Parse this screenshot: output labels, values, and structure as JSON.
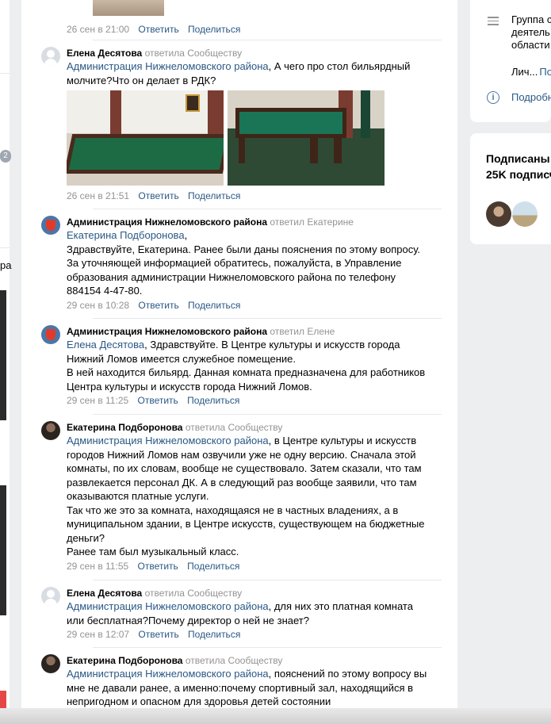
{
  "left_sidebar": {
    "badge": "2",
    "text": "ра"
  },
  "comments": [
    {
      "id": "c0",
      "meta": {
        "time": "26 сен в 21:00",
        "reply": "Ответить",
        "share": "Поделиться"
      }
    },
    {
      "id": "c1",
      "author": "Елена Десятова",
      "replied": "ответила Сообществу",
      "mention": "Администрация Нижнеломовского района",
      "text_after_mention": ", А чего про стол бильярдный молчите?Что он делает в РДК?",
      "meta": {
        "time": "26 сен в 21:51",
        "reply": "Ответить",
        "share": "Поделиться"
      }
    },
    {
      "id": "c2",
      "author": "Администрация Нижнеломовского района",
      "replied": "ответил Екатерине",
      "mention": "Екатерина Подборонова",
      "text_after_mention": ",",
      "paragraphs": [
        "Здравствуйте, Екатерина. Ранее были даны пояснения по этому вопросу. За уточняющей информацией обратитесь, пожалуйста, в Управление образования администрации Нижнеломовского района по телефону 884154 4-47-80."
      ],
      "meta": {
        "time": "29 сен в 10:28",
        "reply": "Ответить",
        "share": "Поделиться"
      }
    },
    {
      "id": "c3",
      "author": "Администрация Нижнеломовского района",
      "replied": "ответил Елене",
      "mention": "Елена Десятова",
      "text_after_mention": ", Здравствуйте. В Центре культуры и искусств города Нижний Ломов имеется служебное помещение.",
      "paragraphs": [
        "В ней находится бильярд. Данная комната предназначена для работников Центра культуры и искусств города Нижний Ломов."
      ],
      "meta": {
        "time": "29 сен в 11:25",
        "reply": "Ответить",
        "share": "Поделиться"
      }
    },
    {
      "id": "c4",
      "author": "Екатерина Подборонова",
      "replied": "ответила Сообществу",
      "mention": "Администрация Нижнеломовского района",
      "text_after_mention": ", в Центре культуры и искусств городов Нижний Ломов нам озвучили уже не одну версию. Сначала этой комнаты, по их словам, вообще не существовало. Затем сказали, что там развлекается персонал ДК. А в следующий раз вообще заявили, что там оказываются платные услуги.",
      "paragraphs": [
        "Так что же это за комната, находящаяся не в частных владениях, а в муниципальном здании, в Центре искусств, существующем на бюджетные деньги?",
        "Ранее там был музыкальный класс."
      ],
      "meta": {
        "time": "29 сен в 11:55",
        "reply": "Ответить",
        "share": "Поделиться"
      }
    },
    {
      "id": "c5",
      "author": "Елена Десятова",
      "replied": "ответила Сообществу",
      "mention": "Администрация Нижнеломовского района",
      "text_after_mention": ", для них это платная комната или бесплатная?Почему директор о ней не знает?",
      "meta": {
        "time": "29 сен в 12:07",
        "reply": "Ответить",
        "share": "Поделиться"
      }
    },
    {
      "id": "c6",
      "author": "Екатерина Подборонова",
      "replied": "ответила Сообществу",
      "mention": "Администрация Нижнеломовского района",
      "text_after_mention": ", пояснений по этому вопросу вы мне не давали ранее, а именно:почему спортивный зал, находящийся в непригодном и опасном для здоровья детей состоянии"
    }
  ],
  "right_info": {
    "group_text_lines": [
      "Группа с",
      "деятель",
      "области"
    ],
    "lich": "Лич...",
    "lich_link": "По",
    "more": "Подробн"
  },
  "subscribers": {
    "title_line1": "Подписаны",
    "title_line2": "25K подписч"
  }
}
